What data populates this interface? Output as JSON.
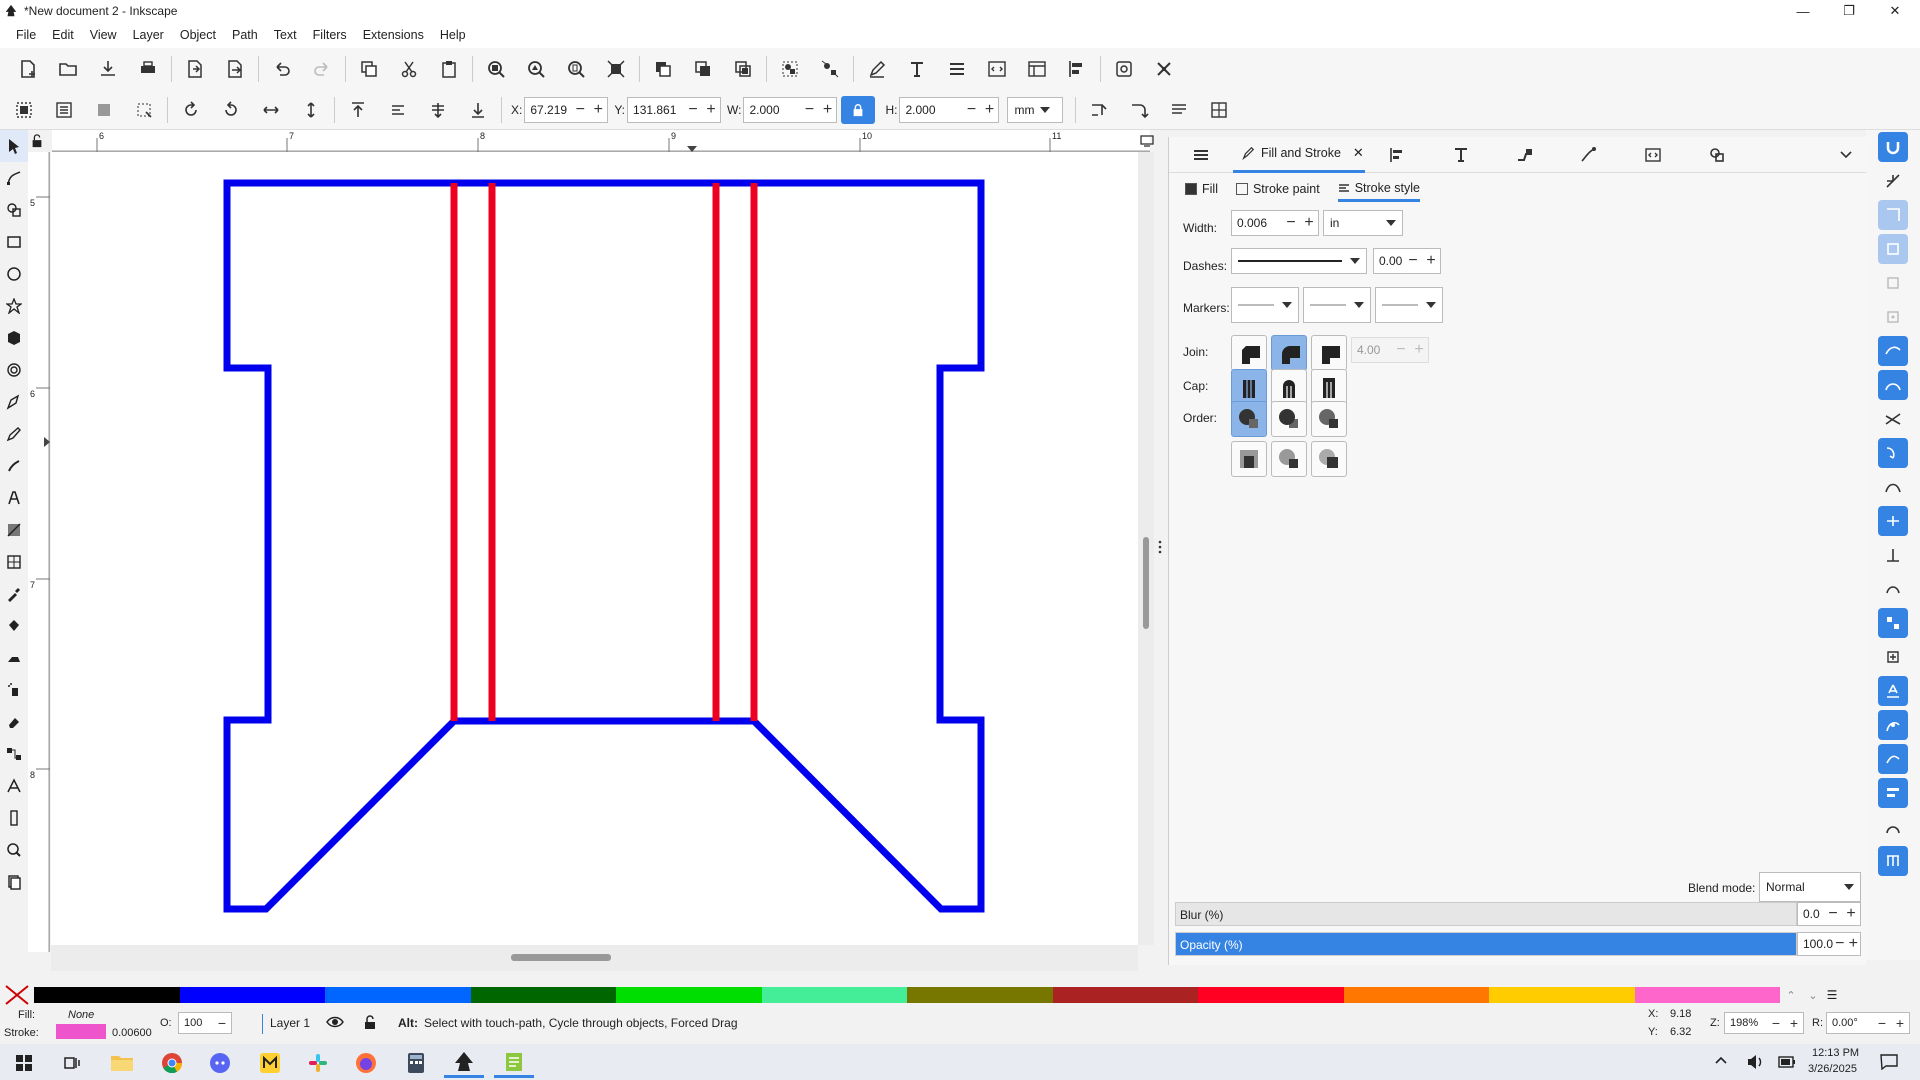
{
  "window": {
    "title": "*New document 2 - Inkscape",
    "icon": "inkscape-icon"
  },
  "menubar": [
    "File",
    "Edit",
    "View",
    "Layer",
    "Object",
    "Path",
    "Text",
    "Filters",
    "Extensions",
    "Help"
  ],
  "toolbar_select": {
    "x_label": "X:",
    "x_value": "67.219",
    "y_label": "Y:",
    "y_value": "131.861",
    "w_label": "W:",
    "w_value": "2.000",
    "h_label": "H:",
    "h_value": "2.000",
    "unit": "mm"
  },
  "ruler_top_labels": [
    "6",
    "7",
    "8",
    "9",
    "10",
    "11"
  ],
  "ruler_left_labels": [
    "5",
    "6",
    "7",
    "8"
  ],
  "dock": {
    "active_tab": "Fill and Stroke",
    "subtabs": {
      "fill": "Fill",
      "stroke_paint": "Stroke paint",
      "stroke_style": "Stroke style"
    },
    "width_label": "Width:",
    "width_value": "0.006",
    "width_unit": "in",
    "dashes_label": "Dashes:",
    "dash_offset": "0.00",
    "markers_label": "Markers:",
    "join_label": "Join:",
    "miter_limit": "4.00",
    "cap_label": "Cap:",
    "order_label": "Order:",
    "blend_label": "Blend mode:",
    "blend_value": "Normal",
    "blur_label": "Blur (%)",
    "blur_value": "0.0",
    "opacity_label": "Opacity (%)",
    "opacity_value": "100.0",
    "opacity_fraction": 1.0
  },
  "palette": [
    "#000000",
    "#0000ff",
    "#0066ff",
    "#006600",
    "#00dd00",
    "#44ee99",
    "#777700",
    "#aa2222",
    "#ff0022",
    "#ff7700",
    "#ffcc00",
    "#ff66cc"
  ],
  "status": {
    "fill_label": "Fill:",
    "fill_value": "None",
    "stroke_label": "Stroke:",
    "stroke_width": "0.00600",
    "stroke_color": "#ee55cc",
    "opacity_label": "O:",
    "opacity_value": "100",
    "layer": "Layer 1",
    "message_bold": "Alt:",
    "message": "Select with touch-path, Cycle through objects, Forced Drag",
    "x_label": "X:",
    "x_value": "9.18",
    "y_label": "Y:",
    "y_value": "6.32",
    "zoom_label": "Z:",
    "zoom_value": "198%",
    "rot_label": "R:",
    "rot_value": "0.00°"
  },
  "taskbar": {
    "time": "12:13 PM",
    "date": "3/26/2025"
  },
  "colors": {
    "blue_stroke": "#0000ee",
    "red_stroke": "#ee0022",
    "accent": "#3584e4"
  }
}
